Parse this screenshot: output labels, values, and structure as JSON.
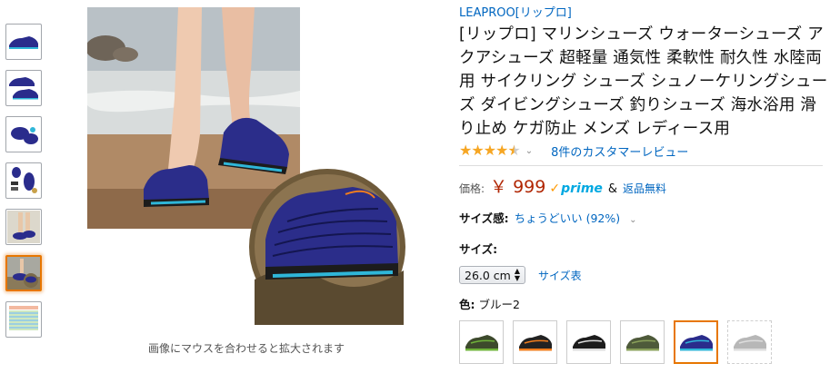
{
  "brand": "LEAPROO[リップロ]",
  "title": "[リップロ] マリンシューズ ウォーターシューズ アクアシューズ 超軽量 通気性 柔軟性 耐久性 水陸両用 サイクリング シューズ シュノーケリングシューズ ダイビングシューズ 釣りシューズ 海水浴用 滑り止め ケガ防止 メンズ レディース用",
  "rating": {
    "stars": 4.5,
    "chevron": "⌄",
    "review_link": "8件のカスタマーレビュー"
  },
  "price": {
    "label": "価格:",
    "value": "￥ 999",
    "prime": "prime",
    "amp": "&",
    "shipping": "返品無料"
  },
  "fit": {
    "label": "サイズ感:",
    "value": "ちょうどいい (92%)",
    "chevron": "⌄"
  },
  "size": {
    "label": "サイズ:",
    "selected": "26.0 cm",
    "chart_link": "サイズ表"
  },
  "color": {
    "label": "色:",
    "value": "ブルー2"
  },
  "image_hint": "画像にマウスを合わせると拡大されます",
  "thumbnails": [
    "shoe-side",
    "shoe-pair",
    "shoe-top",
    "shoe-parts",
    "shoe-wearing",
    "shoe-beach",
    "size-chart"
  ],
  "swatches": [
    {
      "name": "green-black",
      "color": "#3d4a2c",
      "accent": "#6fb33a"
    },
    {
      "name": "black-orange",
      "color": "#222222",
      "accent": "#f07d1e"
    },
    {
      "name": "black-white",
      "color": "#1c1c1c",
      "accent": "#dddddd"
    },
    {
      "name": "army-green",
      "color": "#4e5a3a",
      "accent": "#8aa05a"
    },
    {
      "name": "blue2",
      "color": "#2a2c8c",
      "accent": "#2fb6d8",
      "selected": true
    },
    {
      "name": "grey",
      "color": "#9a9a9a",
      "accent": "#d0d0d0",
      "unavailable": true
    }
  ]
}
